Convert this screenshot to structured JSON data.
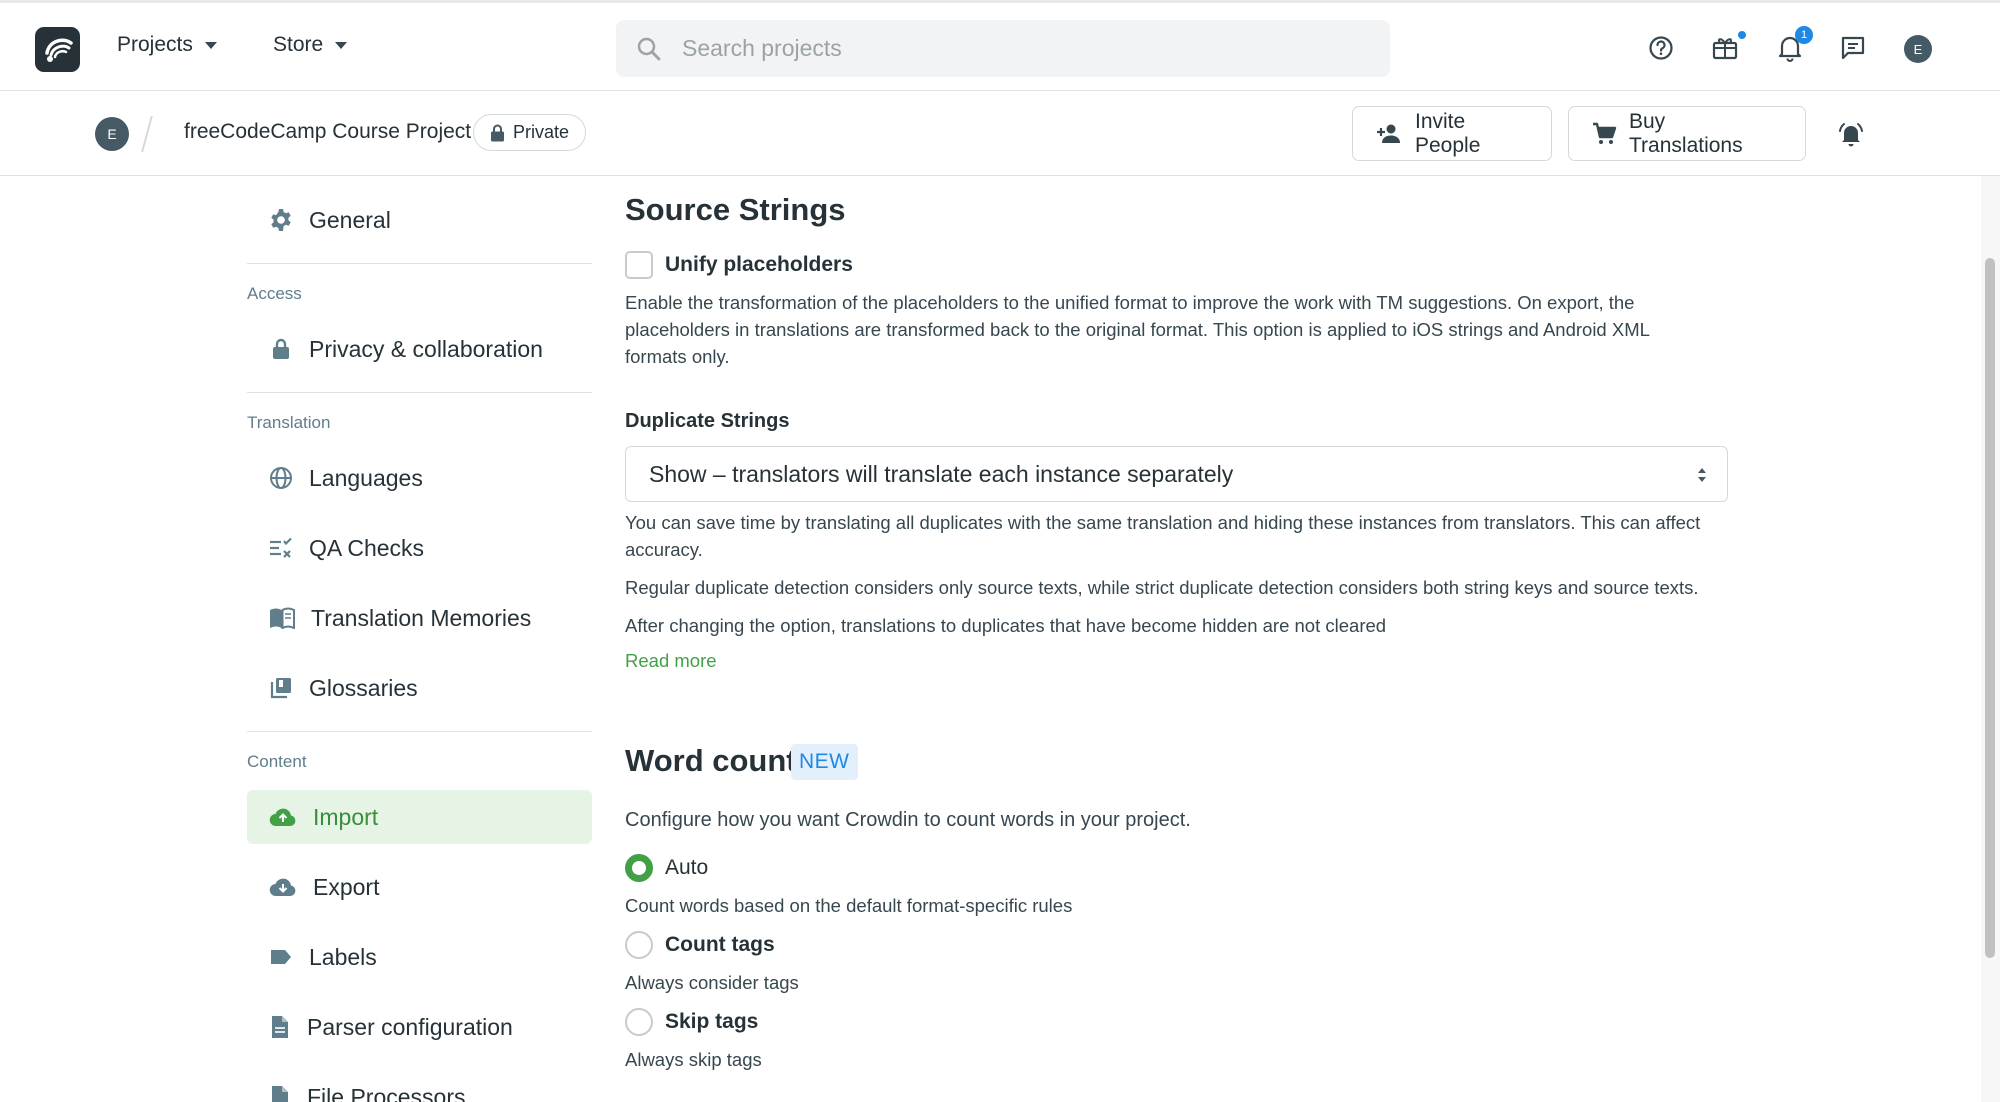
{
  "topbar": {
    "nav": [
      {
        "label": "Projects"
      },
      {
        "label": "Store"
      }
    ],
    "search_placeholder": "Search projects",
    "notification_count": "1",
    "user_initial": "E"
  },
  "project": {
    "initial": "E",
    "name": "freeCodeCamp Course Project",
    "visibility": "Private",
    "invite_label": "Invite People",
    "buy_label": "Buy Translations"
  },
  "sidebar": {
    "general": "General",
    "groups": {
      "access": "Access",
      "translation": "Translation",
      "content": "Content"
    },
    "items": {
      "privacy": "Privacy & collaboration",
      "languages": "Languages",
      "qa": "QA Checks",
      "tm": "Translation Memories",
      "glossaries": "Glossaries",
      "import": "Import",
      "export": "Export",
      "labels": "Labels",
      "parser": "Parser configuration",
      "processors": "File Processors"
    },
    "active": "import"
  },
  "main": {
    "source_strings": {
      "title": "Source Strings",
      "unify_label": "Unify placeholders",
      "unify_checked": false,
      "unify_desc_1": "Enable the transformation of the placeholders to the unified format to improve the work with TM suggestions. On export, the",
      "unify_desc_2": "placeholders in translations are transformed back to the original format. This option is applied to iOS strings and Android XML",
      "unify_desc_3": "formats only."
    },
    "duplicates": {
      "label": "Duplicate Strings",
      "selected": "Show – translators will translate each instance separately",
      "desc_1a": "You can save time by translating all duplicates with the same translation and hiding these instances from translators. This can affect",
      "desc_1b": "accuracy.",
      "desc_2": "Regular duplicate detection considers only source texts, while strict duplicate detection considers both string keys and source texts.",
      "desc_3": "After changing the option, translations to duplicates that have become hidden are not cleared",
      "read_more": "Read more"
    },
    "word_count": {
      "title": "Word count",
      "badge": "NEW",
      "intro": "Configure how you want Crowdin to count words in your project.",
      "options": [
        {
          "label": "Auto",
          "desc": "Count words based on the default format-specific rules",
          "checked": true
        },
        {
          "label": "Count tags",
          "desc": "Always consider tags",
          "checked": false
        },
        {
          "label": "Skip tags",
          "desc": "Always skip tags",
          "checked": false
        }
      ]
    }
  },
  "colors": {
    "accent_green": "#43a047",
    "active_bg": "#e6f4e6",
    "badge_blue": "#1e88e5",
    "text_dark": "#263238"
  },
  "icons": [
    "crowdin-logo-icon",
    "search-icon",
    "help-icon",
    "gift-icon",
    "bell-icon",
    "chat-icon",
    "lock-icon",
    "add-person-icon",
    "cart-icon",
    "bell-ring-icon",
    "gear-icon",
    "globe-icon",
    "qa-check-icon",
    "book-icon",
    "library-icon",
    "cloud-upload-icon",
    "cloud-download-icon",
    "label-icon",
    "file-icon",
    "select-arrows-icon"
  ]
}
